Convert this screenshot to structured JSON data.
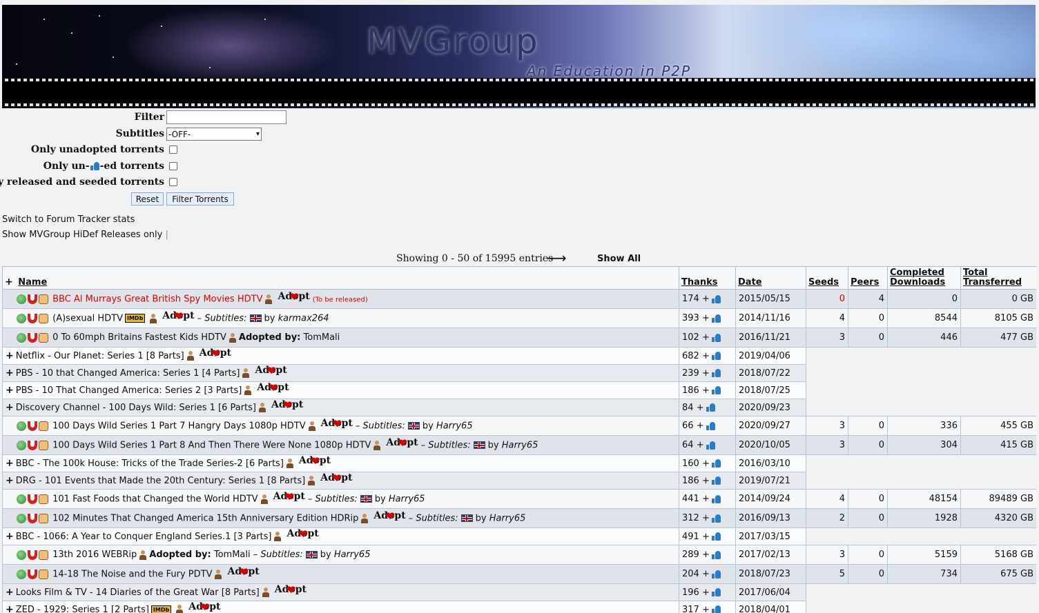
{
  "banner": {
    "title": "MVGroup",
    "tagline": "An Education in P2P"
  },
  "filters": {
    "filter_label": "Filter",
    "filter_value": "",
    "subtitles_label": "Subtitles",
    "subtitles_value": "-OFF-",
    "unadopted_label": "Only unadopted torrents",
    "unthanked_prefix": "Only un-",
    "unthanked_suffix": "-ed torrents",
    "released_label": "Only released and seeded torrents",
    "reset_label": "Reset",
    "submit_label": "Filter Torrents"
  },
  "links": {
    "forum_stats": "Switch to Forum Tracker stats",
    "hidef": "Show MVGroup HiDef Releases only",
    "hidef_sep": "|"
  },
  "pager": {
    "showing": "Showing 0 - 50 of 15995 entries",
    "next_arrow": "⟶",
    "show_all": "Show All"
  },
  "table": {
    "plus": "+",
    "columns": {
      "name": "Name",
      "thanks": "Thanks",
      "date": "Date",
      "seeds": "Seeds",
      "peers": "Peers",
      "completed_1": "Completed",
      "completed_2": "Downloads",
      "total_1": "Total",
      "total_2": "Transferred"
    },
    "adopt_text": "Adopt",
    "to_be_released": "(To be released)",
    "subtitles_label": "Subtitles:",
    "by_label": "by",
    "adopted_by_label": "Adopted by:",
    "dash": "–",
    "thanks_plus": "+",
    "imdb": "IMDb",
    "rows": [
      {
        "kind": "release",
        "name": "BBC Al Murrays Great British Spy Movies HDTV",
        "red": true,
        "tbr": true,
        "thanks": "174",
        "date": "2015/05/15",
        "seeds": "0",
        "peers": "4",
        "completed": "0",
        "total": "0 GB"
      },
      {
        "kind": "release",
        "name": "(A)sexual HDTV",
        "imdb": true,
        "subs": true,
        "uploader": "karmax264",
        "thanks": "393",
        "date": "2014/11/16",
        "seeds": "4",
        "peers": "0",
        "completed": "8544",
        "total": "8105 GB"
      },
      {
        "kind": "release",
        "name": "0 To 60mph Britains Fastest Kids HDTV",
        "adopter": "TomMali",
        "thanks": "102",
        "date": "2016/11/21",
        "seeds": "3",
        "peers": "0",
        "completed": "446",
        "total": "477 GB"
      },
      {
        "kind": "group",
        "name": "Netflix - Our Planet: Series 1 [8 Parts]",
        "thanks": "682",
        "date": "2019/04/06"
      },
      {
        "kind": "group",
        "name": "PBS - 10 that Changed America: Series 1 [4 Parts]",
        "thanks": "239",
        "date": "2018/07/22"
      },
      {
        "kind": "group",
        "name": "PBS - 10 That Changed America: Series 2 [3 Parts]",
        "thanks": "186",
        "date": "2018/07/25"
      },
      {
        "kind": "group",
        "name": "Discovery Channel - 100 Days Wild: Series 1 [6 Parts]",
        "thanks": "84",
        "date": "2020/09/23"
      },
      {
        "kind": "release",
        "name": "100 Days Wild Series 1 Part 7 Hangry Days 1080p HDTV",
        "subs": true,
        "uploader": "Harry65",
        "thanks": "66",
        "date": "2020/09/27",
        "seeds": "3",
        "peers": "0",
        "completed": "336",
        "total": "455 GB"
      },
      {
        "kind": "release",
        "name": "100 Days Wild Series 1 Part 8 And Then There Were None 1080p HDTV",
        "subs": true,
        "uploader": "Harry65",
        "thanks": "64",
        "date": "2020/10/05",
        "seeds": "3",
        "peers": "0",
        "completed": "304",
        "total": "415 GB"
      },
      {
        "kind": "group",
        "name": "BBC - The 100k House: Tricks of the Trade Series-2 [6 Parts]",
        "thanks": "160",
        "date": "2016/03/10"
      },
      {
        "kind": "group",
        "name": "DRG - 101 Events that Made the 20th Century: Series 1 [8 Parts]",
        "thanks": "186",
        "date": "2019/07/21"
      },
      {
        "kind": "release",
        "name": "101 Fast Foods that Changed the World HDTV",
        "subs": true,
        "uploader": "Harry65",
        "thanks": "441",
        "date": "2014/09/24",
        "seeds": "4",
        "peers": "0",
        "completed": "48154",
        "total": "89489 GB"
      },
      {
        "kind": "release",
        "name": "102 Minutes That Changed America 15th Anniversary Edition HDRip",
        "subs": true,
        "uploader": "Harry65",
        "thanks": "312",
        "date": "2016/09/13",
        "seeds": "2",
        "peers": "0",
        "completed": "1928",
        "total": "4320 GB"
      },
      {
        "kind": "group",
        "name": "BBC - 1066: A Year to Conquer England Series.1 [3 Parts]",
        "thanks": "491",
        "date": "2017/03/15"
      },
      {
        "kind": "release",
        "name": "13th 2016 WEBRip",
        "adopter": "TomMali",
        "subs": true,
        "uploader": "Harry65",
        "thanks": "289",
        "date": "2017/02/13",
        "seeds": "3",
        "peers": "0",
        "completed": "5159",
        "total": "5168 GB"
      },
      {
        "kind": "release",
        "name": "14-18 The Noise and the Fury PDTV",
        "thanks": "204",
        "date": "2018/07/23",
        "seeds": "5",
        "peers": "0",
        "completed": "734",
        "total": "675 GB"
      },
      {
        "kind": "group",
        "name": "Looks Film & TV - 14 Diaries of the Great War [8 Parts]",
        "thanks": "196",
        "date": "2017/06/04"
      },
      {
        "kind": "group",
        "name": "ZED - 1929: Series 1 [2 Parts]",
        "imdb": true,
        "thanks": "317",
        "date": "2018/04/01"
      }
    ]
  }
}
